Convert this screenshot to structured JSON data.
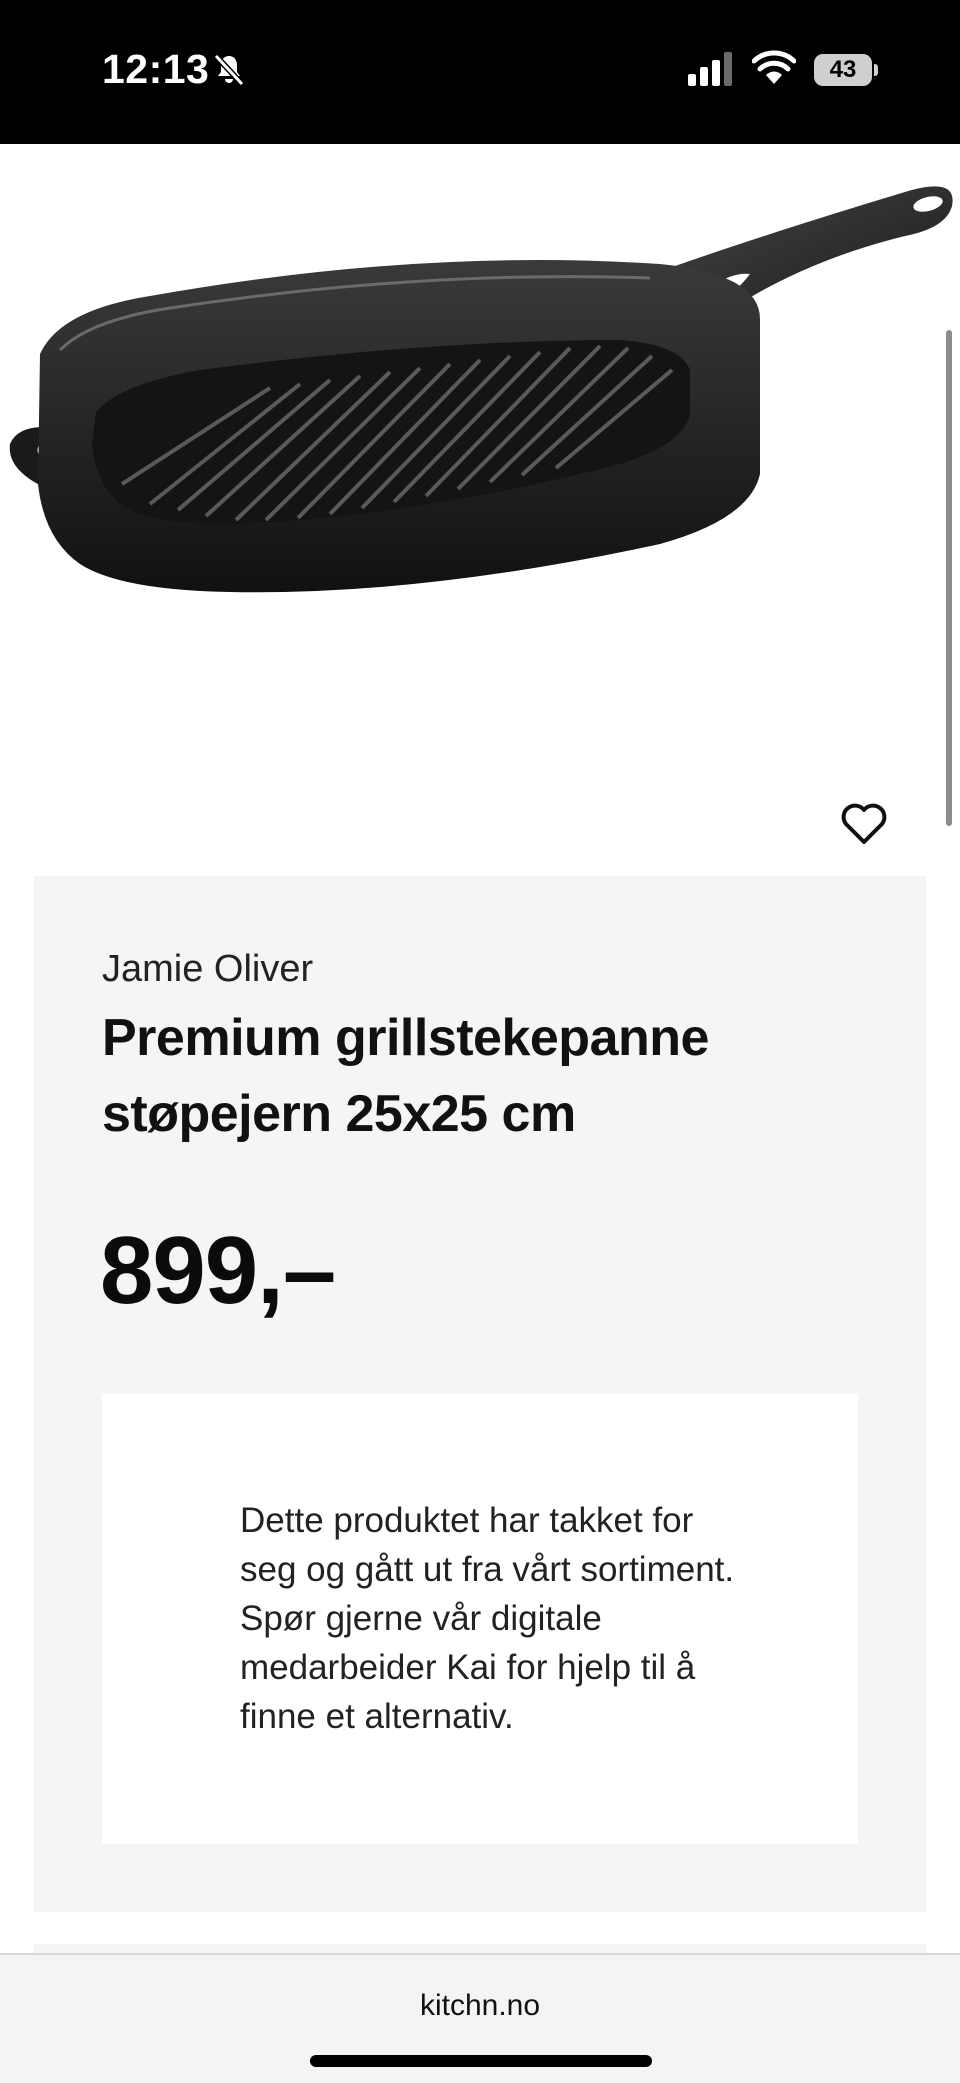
{
  "status_bar": {
    "time": "12:13",
    "battery_level": "43",
    "icons": [
      "bell-slash-icon",
      "cellular-signal-icon",
      "wifi-icon",
      "battery-icon"
    ]
  },
  "product": {
    "image_icon": "grill-pan-image",
    "favorite_icon": "heart-outline-icon",
    "brand": "Jamie Oliver",
    "title": "Premium grillstekepanne støpejern 25x25 cm",
    "price": "899,–",
    "notice": "Dette produktet har takket for seg og gått ut fra vårt sortiment. Spør gjerne vår digitale medarbeider Kai for hjelp til å finne et alternativ."
  },
  "browser": {
    "url": "kitchn.no"
  },
  "colors": {
    "status_bar_bg": "#000000",
    "card_bg": "#f6f4f5",
    "notice_bg": "#ffffff",
    "text": "#111111"
  }
}
